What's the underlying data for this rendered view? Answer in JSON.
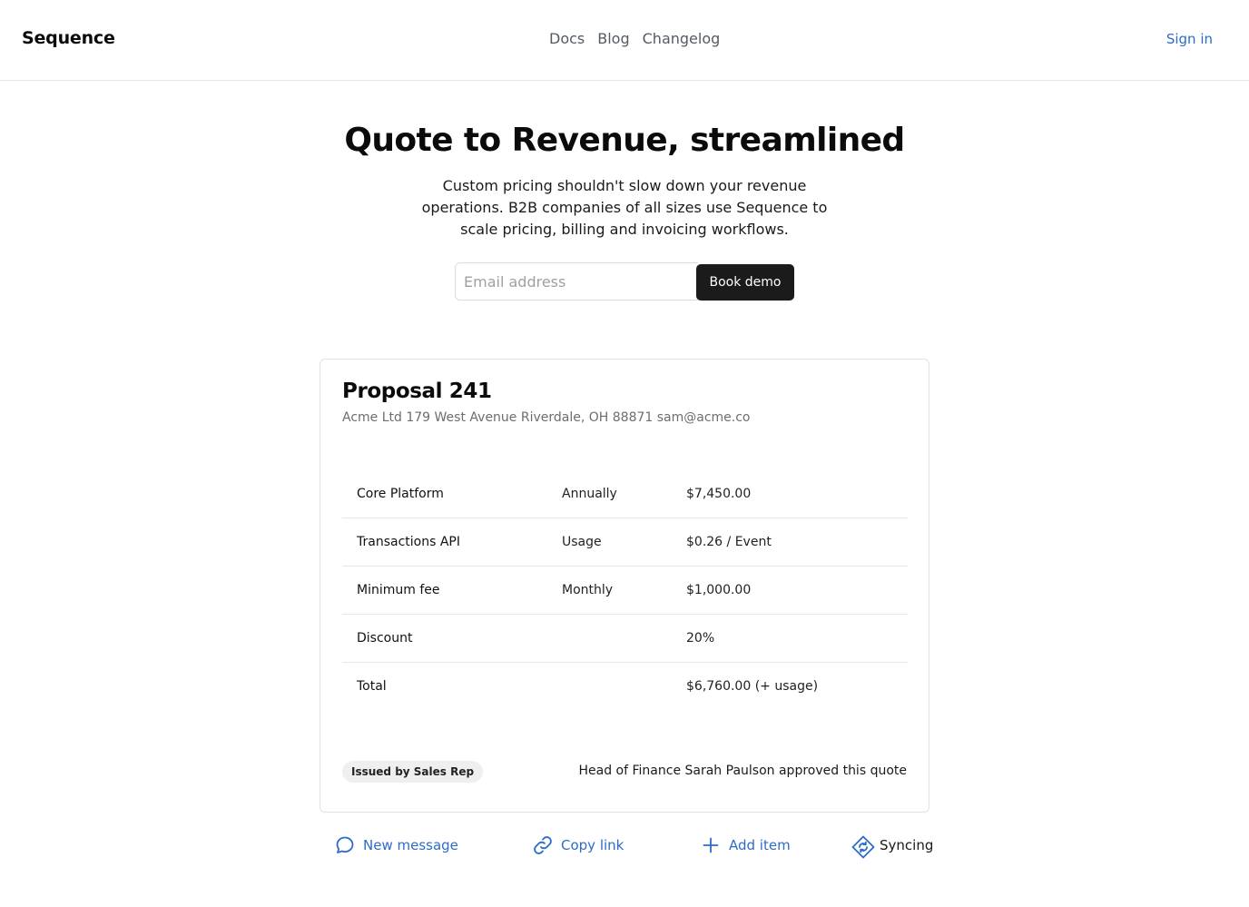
{
  "header": {
    "brand": "Sequence",
    "nav": [
      "Docs",
      "Blog",
      "Changelog"
    ],
    "sign_in": "Sign in"
  },
  "hero": {
    "title": "Quote to Revenue, streamlined",
    "subtitle": "Custom pricing shouldn't slow down your revenue operations. B2B companies of all sizes use Sequence to scale pricing, billing and invoicing workflows.",
    "email_placeholder": "Email address",
    "cta_label": "Book demo"
  },
  "proposal": {
    "title": "Proposal 241",
    "address": "Acme Ltd 179 West Avenue Riverdale, OH 88871 sam@acme.co",
    "rows": [
      {
        "item": "Core Platform",
        "frequency": "Annually",
        "price": "$7,450.00"
      },
      {
        "item": "Transactions API",
        "frequency": "Usage",
        "price": "$0.26 / Event"
      },
      {
        "item": "Minimum fee",
        "frequency": "Monthly",
        "price": "$1,000.00"
      },
      {
        "item": "Discount",
        "frequency": "",
        "price": "20%"
      },
      {
        "item": "Total",
        "frequency": "",
        "price": "$6,760.00 (+ usage)"
      }
    ],
    "badge": "Issued by Sales Rep",
    "approval": "Head of Finance Sarah Paulson approved this quote"
  },
  "actions": {
    "new_message": {
      "label": "New message",
      "icon": "chat-bubble-icon"
    },
    "copy_link": {
      "label": "Copy link",
      "icon": "link-icon"
    },
    "add_item": {
      "label": "Add item",
      "icon": "plus-icon"
    },
    "syncing": {
      "label": "Syncing",
      "icon": "sync-icon"
    }
  },
  "colors": {
    "accent": "#2d6cc9",
    "cta_bg": "#1b1b1b",
    "border": "#e3e3e3"
  }
}
